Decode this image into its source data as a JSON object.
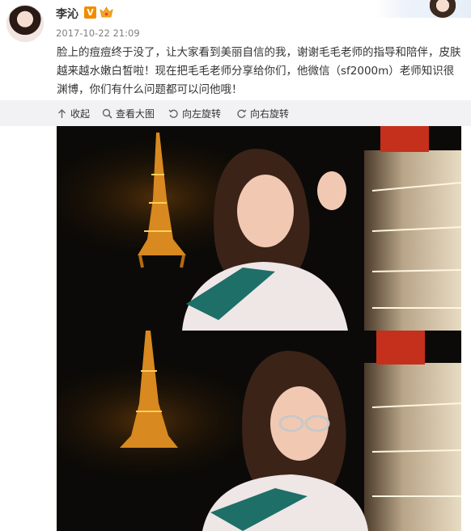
{
  "post": {
    "username": "李沁",
    "verified_badge": "V",
    "timestamp": "2017-10-22 21:09",
    "content": "脸上的痘痘终于没了，让大家看到美丽自信的我，谢谢毛毛老师的指导和陪伴，皮肤越来越水嫩白皙啦！现在把毛毛老师分享给你们，他微信（sf2000m）老师知识很渊博，你们有什么问题都可以问他哦！"
  },
  "toolbar": {
    "collapse": "收起",
    "view_large": "查看大图",
    "rotate_left": "向左旋转",
    "rotate_right": "向右旋转"
  },
  "colors": {
    "toolbar_bg": "#f2f2f5",
    "badge_orange": "#f08c00",
    "text": "#333333",
    "meta": "#808080"
  },
  "icons": [
    "avatar",
    "verified-badge-icon",
    "crown-icon",
    "collapse-icon",
    "zoom-icon",
    "rotate-left-icon",
    "rotate-right-icon"
  ]
}
